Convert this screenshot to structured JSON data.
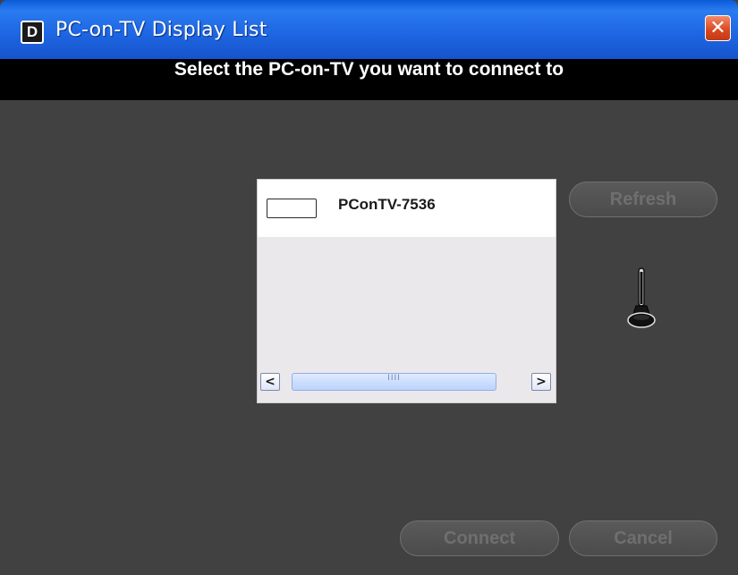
{
  "window": {
    "title": "PC-on-TV Display List",
    "app_icon_letter": "D",
    "close_glyph": "✕"
  },
  "header": {
    "text": "Select the PC-on-TV you want to connect to"
  },
  "device_list": {
    "items": [
      {
        "label": "PConTV-7536",
        "checked": false
      }
    ],
    "scrollbar": {
      "left_glyph": "<",
      "right_glyph": ">",
      "grip": "IIII"
    }
  },
  "buttons": {
    "refresh": "Refresh",
    "connect": "Connect",
    "cancel": "Cancel"
  },
  "icons": {
    "signal": "signal-probe-icon"
  },
  "colors": {
    "titlebar": "#1f67e3",
    "background": "#414141",
    "header_band": "#000000",
    "disabled_text": "#6f6f6f"
  }
}
